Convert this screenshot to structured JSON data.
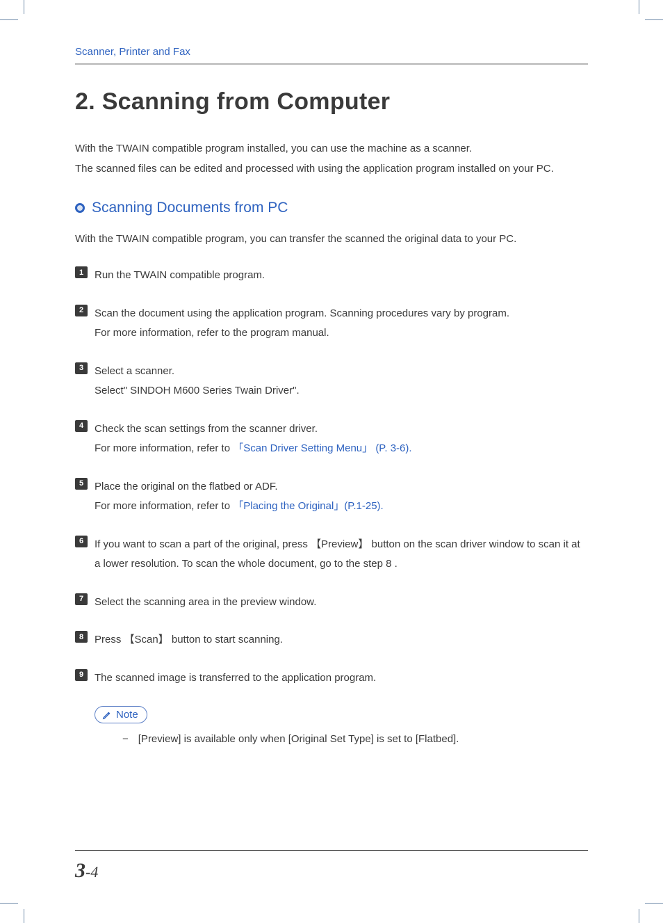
{
  "header": {
    "category": "Scanner, Printer and Fax"
  },
  "title": "2. Scanning from Computer",
  "intro_lines": [
    "With the TWAIN compatible program installed, you can use the machine as a scanner.",
    "The scanned files can be edited and processed with using the application program installed on your PC."
  ],
  "section": {
    "title": "Scanning Documents from PC",
    "desc": "With the TWAIN compatible program, you can transfer the scanned the original data to your PC."
  },
  "steps": [
    {
      "num": "1",
      "lines": [
        "Run the TWAIN compatible program."
      ]
    },
    {
      "num": "2",
      "lines": [
        "Scan the document using the application program. Scanning procedures vary by program.",
        "For more information, refer to the program manual."
      ]
    },
    {
      "num": "3",
      "lines": [
        "Select a scanner.",
        "Select\" SINDOH M600 Series Twain Driver\"."
      ]
    },
    {
      "num": "4",
      "lines_rich": [
        {
          "pre": "Check the scan settings from the scanner driver."
        },
        {
          "pre": "For more information, refer to ",
          "link": "「Scan Driver Setting Menu」 (P. 3-6)."
        }
      ]
    },
    {
      "num": "5",
      "lines_rich": [
        {
          "pre": "Place the original on the flatbed or ADF."
        },
        {
          "pre": "For more information, refer to ",
          "link": "「Placing the Original」(P.1-25)."
        }
      ]
    },
    {
      "num": "6",
      "lines": [
        "If you want to scan a part of the original, press 【Preview】 button on the scan driver window to scan it at a lower resolution. To scan the whole document, go to the step 8 ."
      ]
    },
    {
      "num": "7",
      "lines": [
        "Select the scanning area in the preview window."
      ]
    },
    {
      "num": "8",
      "lines": [
        "Press 【Scan】 button to start scanning."
      ]
    },
    {
      "num": "9",
      "lines": [
        "The scanned image is transferred to the application program."
      ]
    }
  ],
  "note": {
    "label": "Note",
    "items": [
      "[Preview] is available only when [Original Set Type] is set to [Flatbed]."
    ]
  },
  "page_number": {
    "chapter": "3",
    "sep": "-",
    "page": "4"
  }
}
